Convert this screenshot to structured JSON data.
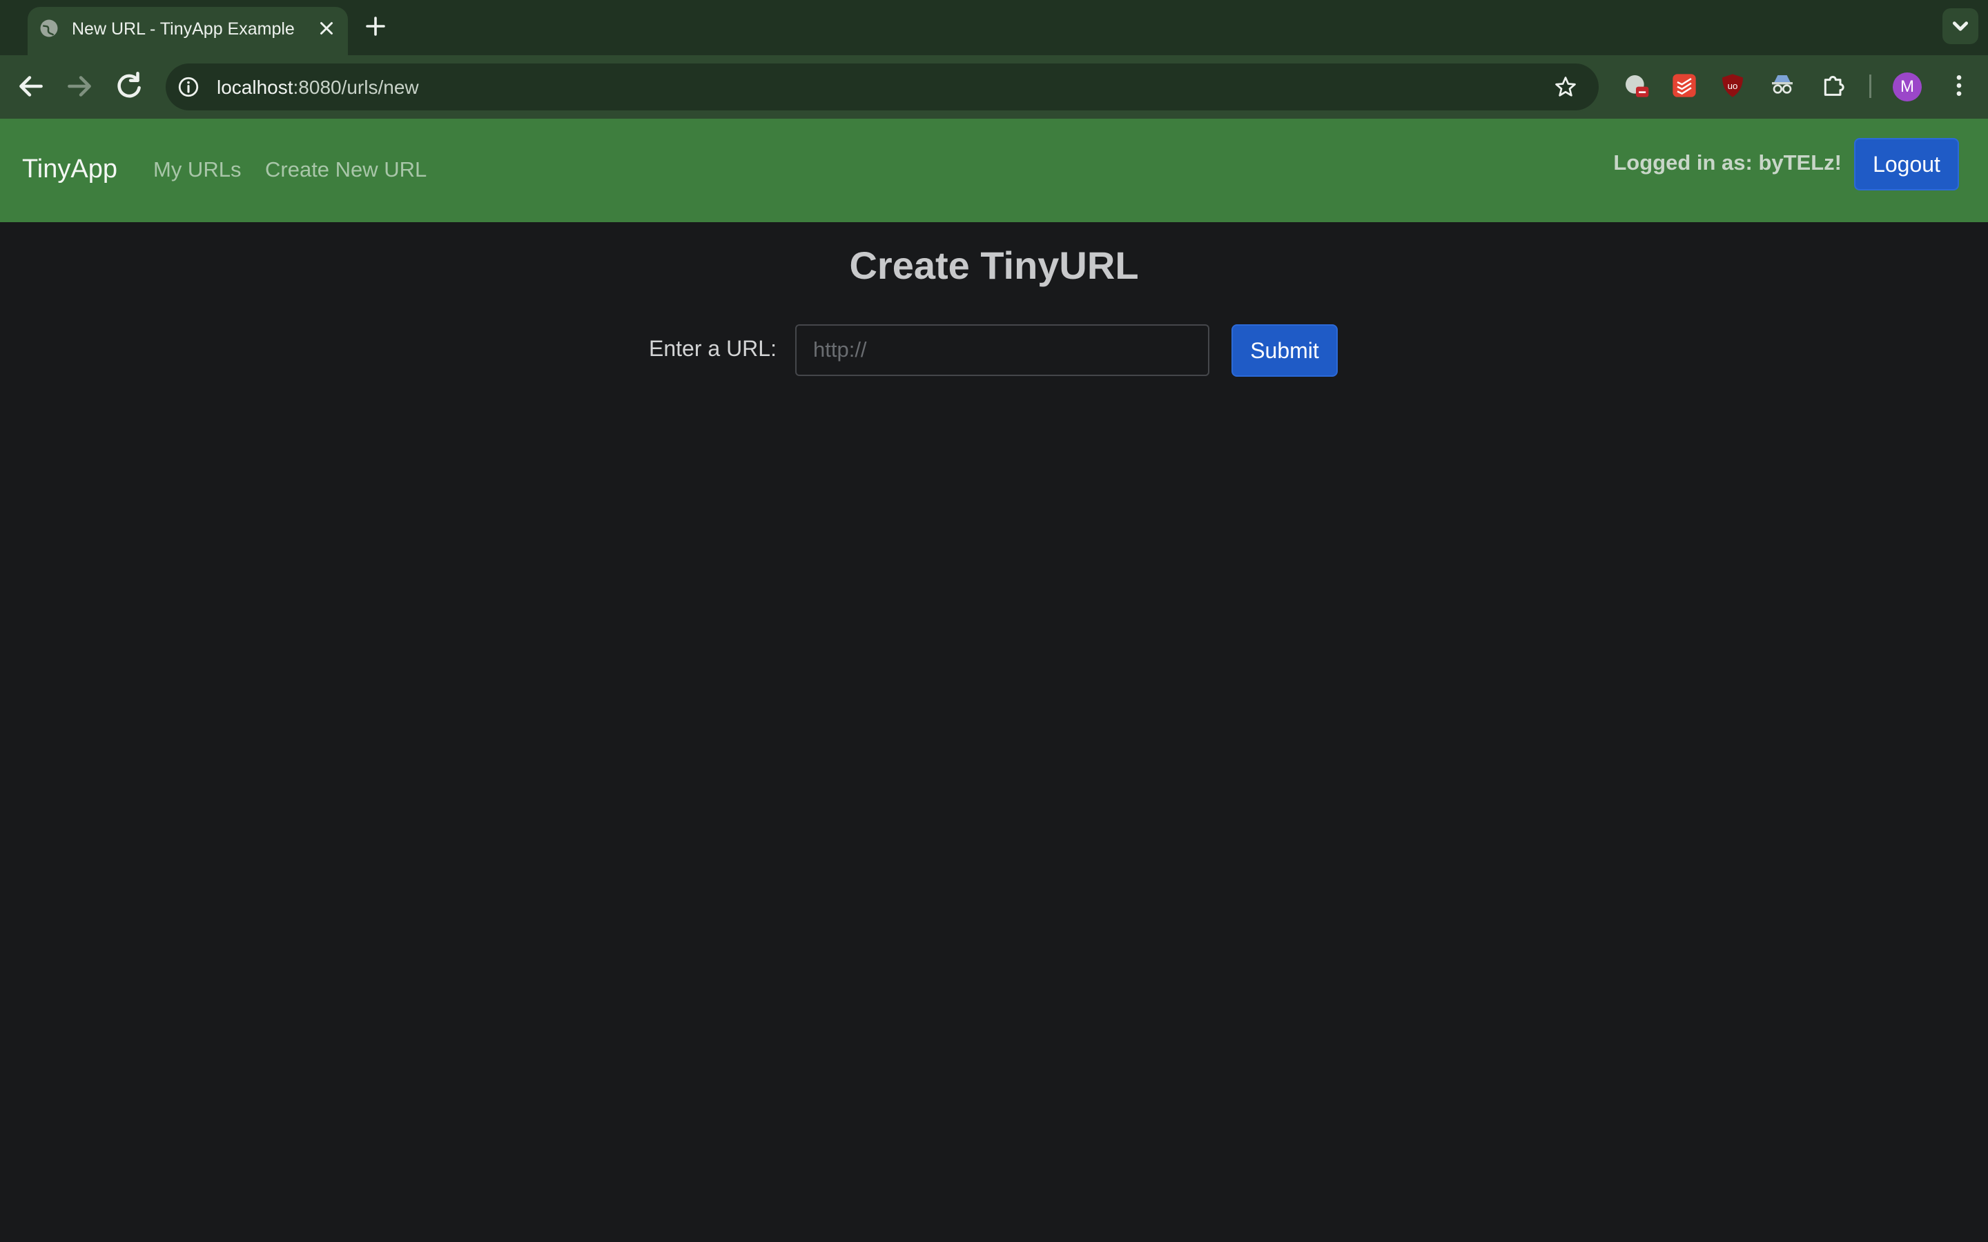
{
  "browser": {
    "tab_title": "New URL - TinyApp Example",
    "url_host": "localhost",
    "url_path": ":8080/urls/new",
    "profile_initial": "M"
  },
  "navbar": {
    "brand": "TinyApp",
    "links": [
      "My URLs",
      "Create New URL"
    ],
    "logged_in_text": "Logged in as: byTELz!",
    "logout_label": "Logout"
  },
  "main": {
    "heading": "Create TinyURL",
    "url_label": "Enter a URL:",
    "url_placeholder": "http://",
    "submit_label": "Submit"
  },
  "colors": {
    "navbar_bg": "#3e7e3e",
    "page_bg": "#18191b",
    "button_primary": "#1f5bc6",
    "browser_chrome": "#2f4a30"
  }
}
